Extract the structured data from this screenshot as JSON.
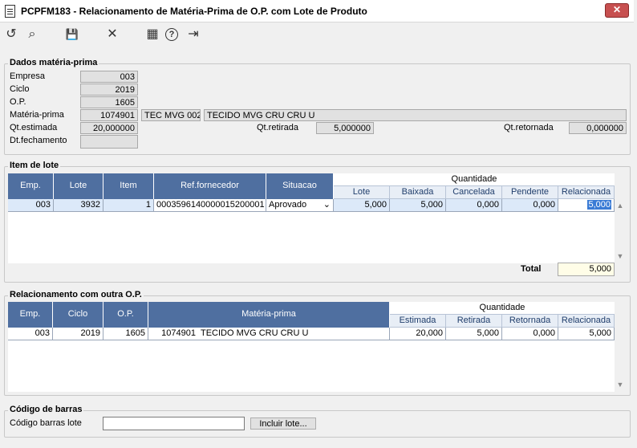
{
  "window": {
    "title": "PCPFM183 - Relacionamento de Matéria-Prima de O.P. com Lote de Produto",
    "close_glyph": "✕"
  },
  "toolbar": {
    "refresh_glyph": "↺",
    "search_glyph": "⌕",
    "save_glyph": "💾",
    "cancel_glyph": "✕",
    "calendar_glyph": "▦",
    "help_glyph": "?",
    "exit_glyph": "⇥"
  },
  "dados": {
    "legend": "Dados matéria-prima",
    "empresa_label": "Empresa",
    "empresa_value": "003",
    "ciclo_label": "Ciclo",
    "ciclo_value": "2019",
    "op_label": "O.P.",
    "op_value": "1605",
    "materia_label": "Matéria-prima",
    "materia_code": "1074901",
    "materia_short": "TEC MVG 002",
    "materia_desc": "TECIDO MVG CRU CRU U",
    "qt_estimada_label": "Qt.estimada",
    "qt_estimada_value": "20,000000",
    "qt_retirada_label": "Qt.retirada",
    "qt_retirada_value": "5,000000",
    "qt_retornada_label": "Qt.retornada",
    "qt_retornada_value": "0,000000",
    "dt_fechamento_label": "Dt.fechamento",
    "dt_fechamento_value": ""
  },
  "lote": {
    "legend": "Item de lote",
    "headers": {
      "emp": "Emp.",
      "lote": "Lote",
      "item": "Item",
      "ref": "Ref.fornecedor",
      "situacao": "Situacao",
      "quantidade": "Quantidade",
      "q_lote": "Lote",
      "q_baixada": "Baixada",
      "q_cancelada": "Cancelada",
      "q_pendente": "Pendente",
      "q_relacionada": "Relacionada"
    },
    "row": {
      "emp": "003",
      "lote": "3932",
      "item": "1",
      "ref": "000359614000001520000​1",
      "situacao": "Aprovado",
      "q_lote": "5,000",
      "q_baixada": "5,000",
      "q_cancelada": "0,000",
      "q_pendente": "0,000",
      "q_relacionada": "5,000"
    },
    "total_label": "Total",
    "total_value": "5,000"
  },
  "rel": {
    "legend": "Relacionamento com outra O.P.",
    "headers": {
      "emp": "Emp.",
      "ciclo": "Ciclo",
      "op": "O.P.",
      "materia": "Matéria-prima",
      "quantidade": "Quantidade",
      "estimada": "Estimada",
      "retirada": "Retirada",
      "retornada": "Retornada",
      "relacionada": "Relacionada"
    },
    "row": {
      "emp": "003",
      "ciclo": "2019",
      "op": "1605",
      "materia_code": "1074901",
      "materia_desc": "TECIDO MVG CRU CRU U",
      "estimada": "20,000",
      "retirada": "5,000",
      "retornada": "0,000",
      "relacionada": "5,000"
    }
  },
  "barcode": {
    "legend": "Código de barras",
    "label": "Código barras lote",
    "value": "",
    "button": "Incluir lote..."
  }
}
